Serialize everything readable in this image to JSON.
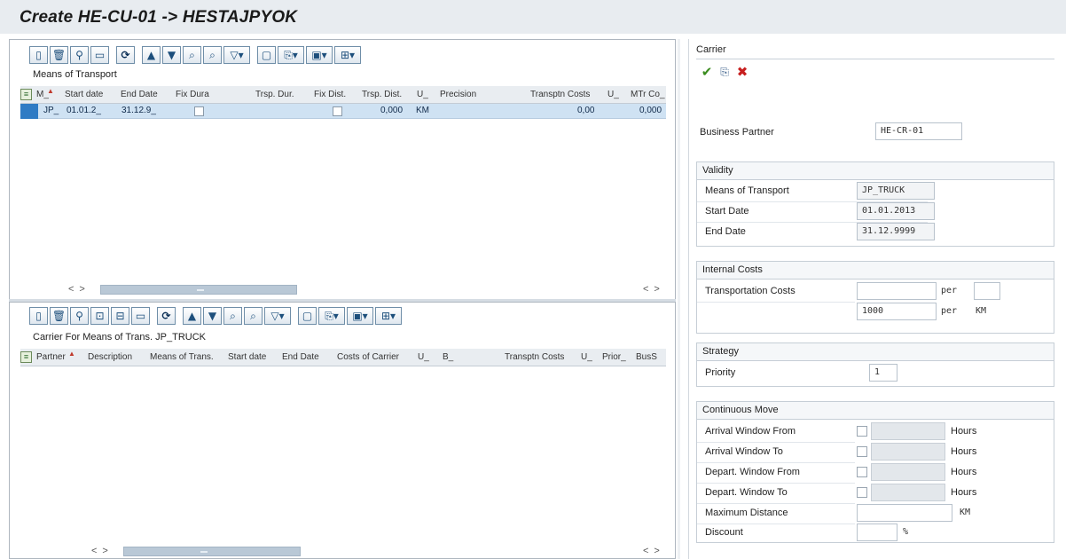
{
  "window": {
    "title": "Create HE-CU-01 -> HESTAJPYOK"
  },
  "top_grid": {
    "section_label": "Means of Transport",
    "columns": [
      "M_",
      "Start date",
      "End Date",
      "Fix Dura",
      "Trsp. Dur.",
      "Fix Dist.",
      "Trsp. Dist.",
      "U_",
      "Precision",
      "Transptn Costs",
      "U_",
      "MTr Co_"
    ],
    "row": {
      "means": "JP_",
      "start_date": "01.01.2_",
      "end_date": "31.12.9_",
      "fix_duration": false,
      "fix_distance": false,
      "trsp_dist": "0,000",
      "unit": "KM",
      "transptn_costs": "0,00",
      "mtr_costs": "0,000"
    }
  },
  "bottom_grid": {
    "section_label": "Carrier For Means of Trans. JP_TRUCK",
    "columns": [
      "Partner",
      "Description",
      "Means of Trans.",
      "Start date",
      "End Date",
      "Costs of Carrier",
      "U_",
      "B_",
      "Transptn Costs",
      "U_",
      "Prior_",
      "BusS"
    ]
  },
  "toolbar_icons": [
    "new-document-icon",
    "delete-icon",
    "zoom-icon",
    "details-icon",
    "refresh-icon",
    "sort-ascending-icon",
    "filter-icon",
    "find-icon",
    "find-next-icon",
    "set-filter-icon",
    "print-icon",
    "export-icon",
    "spreadsheet-icon",
    "layout-icon"
  ],
  "right_panel": {
    "header": "Carrier",
    "tools": {
      "confirm": "✔",
      "copy": "⎘",
      "cancel": "✖"
    },
    "business_partner": {
      "label": "Business Partner",
      "value": "HE-CR-01"
    },
    "validity": {
      "title": "Validity",
      "means_label": "Means of Transport",
      "means_value": "JP_TRUCK",
      "start_label": "Start Date",
      "start_value": "01.01.2013",
      "end_label": "End Date",
      "end_value": "31.12.9999"
    },
    "internal_costs": {
      "title": "Internal Costs",
      "transport_label": "Transportation Costs",
      "per": "per",
      "row2_value": "1000",
      "row2_unit": "KM"
    },
    "strategy": {
      "title": "Strategy",
      "priority_label": "Priority",
      "priority_value": "1"
    },
    "continuous_move": {
      "title": "Continuous Move",
      "arrival_from": "Arrival Window From",
      "arrival_to": "Arrival Window To",
      "depart_from": "Depart. Window From",
      "depart_to": "Depart. Window To",
      "hours": "Hours",
      "max_distance": "Maximum Distance",
      "max_distance_unit": "KM",
      "discount": "Discount",
      "discount_unit": "%"
    }
  }
}
